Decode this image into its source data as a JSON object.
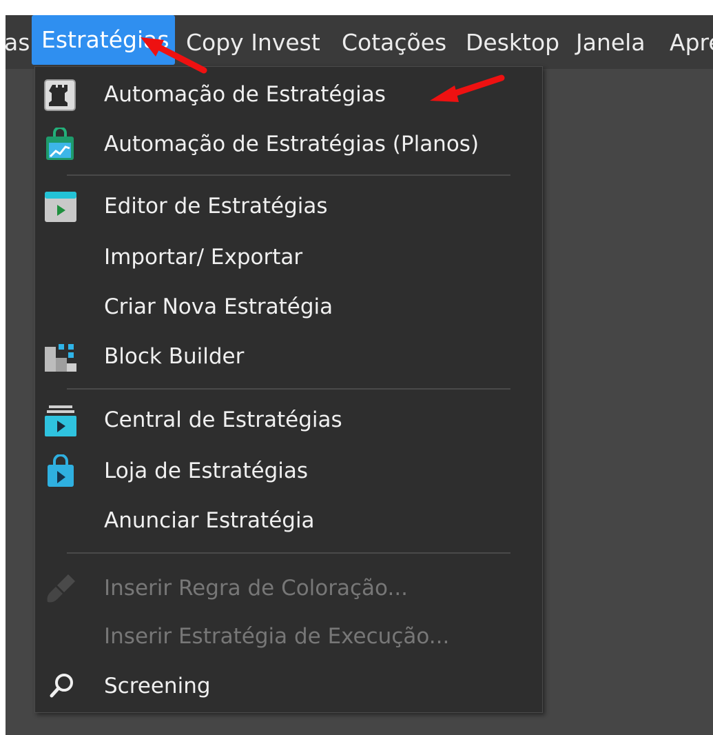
{
  "menubar": {
    "items": [
      "as",
      "Estratégias",
      "Copy Invest",
      "Cotações",
      "Desktop",
      "Janela",
      "Apre"
    ]
  },
  "dropdown": {
    "items": [
      {
        "label": "Automação de Estratégias",
        "icon": "rook-icon",
        "enabled": true
      },
      {
        "label": "Automação de Estratégias (Planos)",
        "icon": "shopping-bag-chart-icon",
        "enabled": true
      },
      {
        "label": "Editor de Estratégias",
        "icon": "play-window-icon",
        "enabled": true
      },
      {
        "label": "Importar/ Exportar",
        "icon": null,
        "enabled": true
      },
      {
        "label": "Criar Nova Estratégia",
        "icon": null,
        "enabled": true
      },
      {
        "label": "Block Builder",
        "icon": "blocks-icon",
        "enabled": true
      },
      {
        "label": "Central de Estratégias",
        "icon": "stack-play-icon",
        "enabled": true
      },
      {
        "label": "Loja de Estratégias",
        "icon": "bag-play-icon",
        "enabled": true
      },
      {
        "label": "Anunciar Estratégia",
        "icon": null,
        "enabled": true
      },
      {
        "label": "Inserir Regra de Coloração...",
        "icon": "paintbrush-icon",
        "enabled": false
      },
      {
        "label": "Inserir Estratégia de Execução...",
        "icon": null,
        "enabled": false
      },
      {
        "label": "Screening",
        "icon": "magnifier-icon",
        "enabled": true
      }
    ]
  },
  "colors": {
    "menubar_bg": "#3a3a3a",
    "active_menu": "#2f8ff0",
    "dropdown_bg": "#2e2e2e",
    "text": "#f0f0f0",
    "disabled_text": "#777777",
    "arrow": "#ee1111"
  }
}
